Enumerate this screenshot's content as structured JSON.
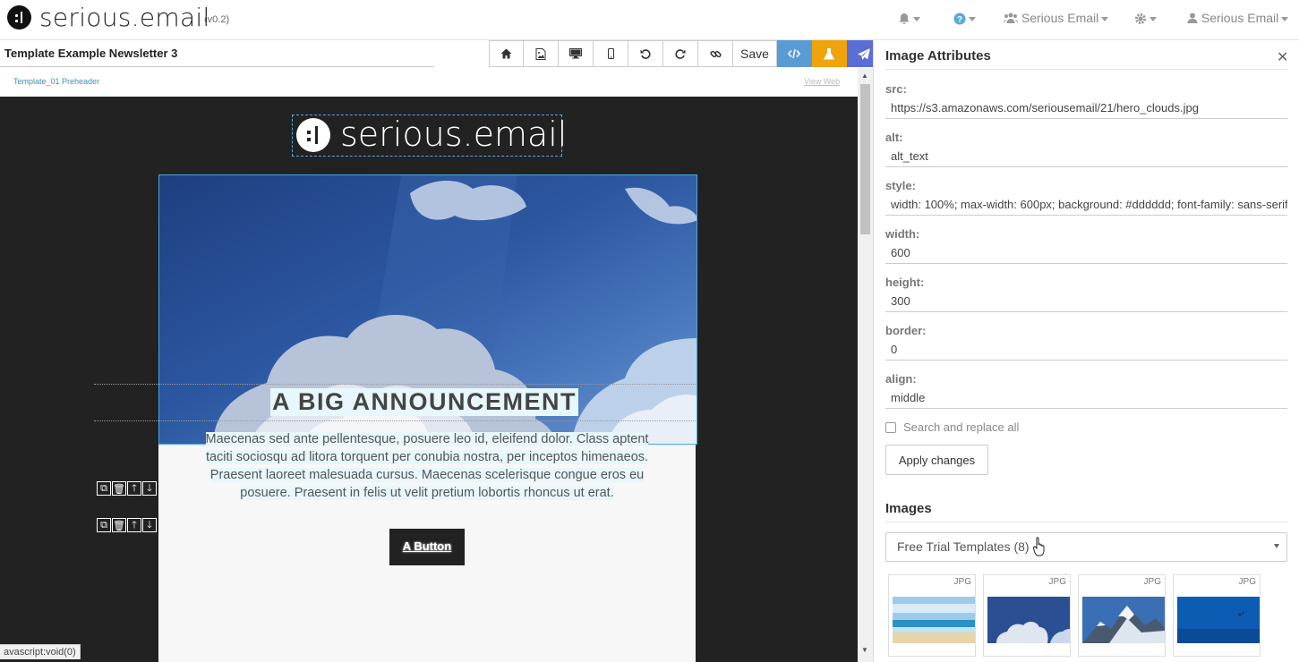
{
  "app": {
    "brand": "serious.email",
    "version": "(v0.2)",
    "nav": {
      "notifications_icon": "bell-icon",
      "help_icon": "question-circle-icon",
      "team_label": "Serious Email",
      "settings_icon": "gear-icon",
      "user_label": "Serious Email"
    }
  },
  "editor": {
    "template_name": "Template Example Newsletter 3",
    "toolbar": {
      "icons": [
        "home-icon",
        "image-icon",
        "desktop-icon",
        "mobile-icon",
        "undo-icon",
        "redo-icon",
        "link-icon"
      ],
      "save_label": "Save",
      "code_icon": "code-icon",
      "test_icon": "flask-icon",
      "send_icon": "paper-plane-icon",
      "colors": {
        "code": "#5b9bd5",
        "test": "#f0a30a",
        "send": "#5a6ed6"
      }
    },
    "preheader": "Template_01 Preheader",
    "view_web": "View Web",
    "status_bar": "avascript:void(0)"
  },
  "email": {
    "logo_text": "serious.email",
    "headline": "A BIG ANNOUNCEMENT",
    "paragraph": "Maecenas sed ante pellentesque, posuere leo id, eleifend dolor. Class aptent taciti sociosqu ad litora torquent per conubia nostra, per inceptos himenaeos. Praesent laoreet malesuada cursus. Maecenas scelerisque congue eros eu posuere. Praesent in felis ut velit pretium lobortis rhoncus ut erat.",
    "button_label": "A Button",
    "canvas_bg": "#222222"
  },
  "panel": {
    "title": "Image Attributes",
    "close_icon": "close-icon",
    "fields": [
      {
        "label": "src:",
        "value": "https://s3.amazonaws.com/seriousemail/21/hero_clouds.jpg"
      },
      {
        "label": "alt:",
        "value": "alt_text"
      },
      {
        "label": "style:",
        "value": "width: 100%; max-width: 600px; background: #dddddd; font-family: sans-serif"
      },
      {
        "label": "width:",
        "value": "600"
      },
      {
        "label": "height:",
        "value": "300"
      },
      {
        "label": "border:",
        "value": "0"
      },
      {
        "label": "align:",
        "value": "middle"
      }
    ],
    "search_replace_label": "Search and replace all",
    "apply_label": "Apply changes",
    "images_title": "Images",
    "folder_selected": "Free Trial Templates (8)",
    "thumbnails": [
      {
        "type": "JPG",
        "subject": "beach"
      },
      {
        "type": "JPG",
        "subject": "clouds"
      },
      {
        "type": "JPG",
        "subject": "mountains"
      },
      {
        "type": "JPG",
        "subject": "underwater"
      }
    ]
  }
}
